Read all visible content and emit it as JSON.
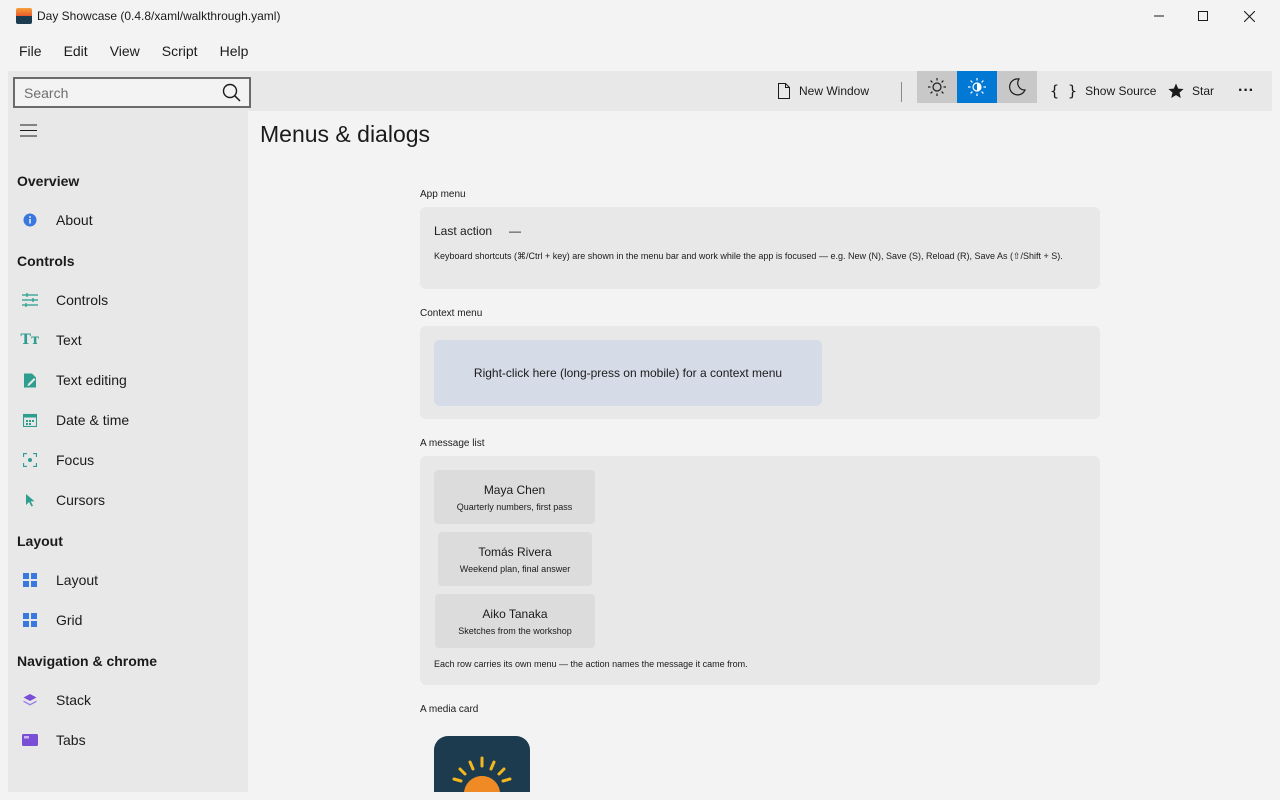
{
  "window": {
    "title": "Day Showcase (0.4.8/xaml/walkthrough.yaml)"
  },
  "menu": [
    "File",
    "Edit",
    "View",
    "Script",
    "Help"
  ],
  "search": {
    "placeholder": "Search",
    "value": ""
  },
  "toolbar": {
    "new_window": "New Window",
    "show_source": "Show Source",
    "star": "Star",
    "more": "···",
    "accent": "#0078d4"
  },
  "nav": {
    "groups": [
      {
        "title": "Overview",
        "items": [
          {
            "label": "About",
            "icon": "info-icon"
          }
        ]
      },
      {
        "title": "Controls",
        "items": [
          {
            "label": "Controls",
            "icon": "sliders-icon"
          },
          {
            "label": "Text",
            "icon": "text-icon"
          },
          {
            "label": "Text editing",
            "icon": "edit-icon"
          },
          {
            "label": "Date & time",
            "icon": "calendar-icon"
          },
          {
            "label": "Focus",
            "icon": "focus-icon"
          },
          {
            "label": "Cursors",
            "icon": "cursor-icon"
          }
        ]
      },
      {
        "title": "Layout",
        "items": [
          {
            "label": "Layout",
            "icon": "layout-icon"
          },
          {
            "label": "Grid",
            "icon": "grid-icon"
          }
        ]
      },
      {
        "title": "Navigation & chrome",
        "items": [
          {
            "label": "Stack",
            "icon": "stack-icon"
          },
          {
            "label": "Tabs",
            "icon": "tabs-icon"
          }
        ]
      }
    ]
  },
  "page": {
    "title": "Menus & dialogs",
    "app_menu": {
      "label": "App menu",
      "last_action_label": "Last action",
      "last_action_value": "—",
      "note": "Keyboard shortcuts (⌘/Ctrl + key) are shown in the menu bar and work while the app is focused — e.g. New (N), Save (S), Reload (R), Save As (⇧/Shift + S)."
    },
    "context_menu": {
      "label": "Context menu",
      "target_text": "Right-click here (long-press on mobile) for a context menu"
    },
    "message_list": {
      "label": "A message list",
      "messages": [
        {
          "name": "Maya Chen",
          "subject": "Quarterly numbers, first pass"
        },
        {
          "name": "Tomás Rivera",
          "subject": "Weekend plan, final answer"
        },
        {
          "name": "Aiko Tanaka",
          "subject": "Sketches from the workshop"
        }
      ],
      "note": "Each row carries its own menu — the action names the message it came from."
    },
    "media_card": {
      "label": "A media card"
    }
  }
}
